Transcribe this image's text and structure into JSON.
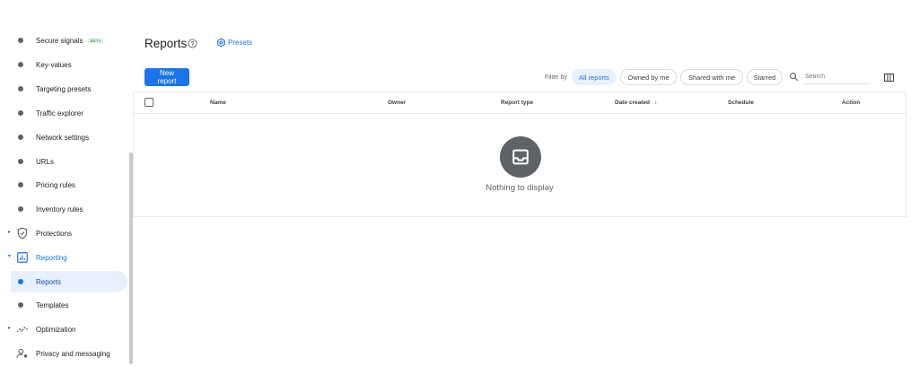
{
  "sidebar": {
    "items": [
      {
        "label": "Secure signals",
        "badge": "BETA"
      },
      {
        "label": "Key-values"
      },
      {
        "label": "Targeting presets"
      },
      {
        "label": "Traffic explorer"
      },
      {
        "label": "Network settings"
      },
      {
        "label": "URLs"
      },
      {
        "label": "Pricing rules"
      },
      {
        "label": "Inventory rules"
      },
      {
        "label": "Protections",
        "icon": "shield-icon"
      },
      {
        "label": "Reporting",
        "icon": "bar-chart-icon"
      },
      {
        "label": "Reports",
        "selected": true
      },
      {
        "label": "Templates"
      },
      {
        "label": "Optimization",
        "icon": "trend-icon"
      },
      {
        "label": "Privacy and messaging",
        "icon": "person-settings-icon"
      }
    ]
  },
  "header": {
    "title": "Reports",
    "presets_label": "Presets"
  },
  "toolbar": {
    "new_report_label": "New report",
    "filter_label": "Filter by",
    "chips": [
      "All reports",
      "Owned by me",
      "Shared with me",
      "Starred"
    ],
    "active_chip": "All reports",
    "search_placeholder": "Search"
  },
  "table": {
    "columns": [
      "Name",
      "Owner",
      "Report type",
      "Date created",
      "Schedule",
      "Action"
    ],
    "sorted_column": "Date created",
    "empty_message": "Nothing to display"
  },
  "colors": {
    "accent": "#1a73e8",
    "selected_bg": "#e8f0fe",
    "icon_gray": "#5f6368"
  }
}
